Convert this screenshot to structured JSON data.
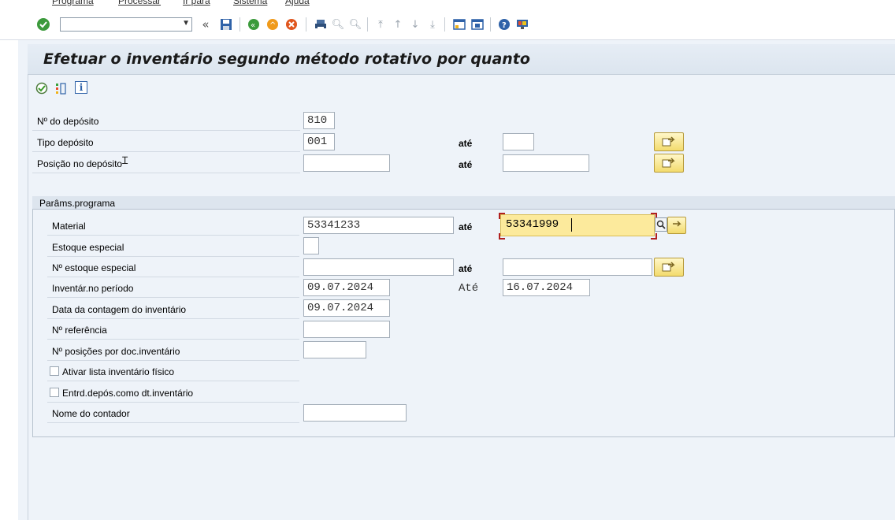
{
  "menu": [
    "Programa",
    "Processar",
    "Ir para",
    "Sistema",
    "Ajuda"
  ],
  "toolbar": {
    "command_field_value": "",
    "icons": [
      "enter-icon",
      "save-icon",
      "back-icon",
      "exit-icon",
      "cancel-icon",
      "print-icon",
      "find-icon",
      "find-next-icon",
      "first-page-icon",
      "prev-page-icon",
      "next-page-icon",
      "last-page-icon",
      "create-session-icon",
      "shortcut-icon",
      "help-icon",
      "customize-layout-icon"
    ]
  },
  "page_title": "Efetuar o inventário segundo método rotativo por quanto",
  "app_toolbar": [
    "execute-icon",
    "selection-options-icon",
    "info-icon"
  ],
  "header_fields": {
    "deposit_no_label": "Nº do depósito",
    "deposit_no_value": "810",
    "deposit_type_label": "Tipo depósito",
    "deposit_type_value": "001",
    "deposit_type_to_label": "até",
    "deposit_type_to_value": "",
    "bin_label": "Posição no depósito",
    "bin_value": "",
    "bin_to_label": "até",
    "bin_to_value": ""
  },
  "params": {
    "group_title": "Parâms.programa",
    "material_label": "Material",
    "material_from": "53341233",
    "material_to_label": "até",
    "material_to": "53341999",
    "special_stock_label": "Estoque especial",
    "special_stock_no_label": "Nº estoque especial",
    "special_stock_no_from": "",
    "special_stock_no_to_label": "até",
    "special_stock_no_to": "",
    "period_label": "Inventár.no período",
    "period_from": "09.07.2024",
    "period_to_label": "Até",
    "period_to": "16.07.2024",
    "count_date_label": "Data da contagem do inventário",
    "count_date_value": "09.07.2024",
    "reference_label": "Nº referência",
    "reference_value": "",
    "positions_label": "Nº posições por doc.inventário",
    "positions_value": "",
    "activate_list_label": "Ativar lista inventário físico",
    "activate_list_checked": false,
    "entry_date_label": "Entrd.depós.como dt.inventário",
    "entry_date_checked": false,
    "counter_name_label": "Nome do contador",
    "counter_name_value": ""
  }
}
